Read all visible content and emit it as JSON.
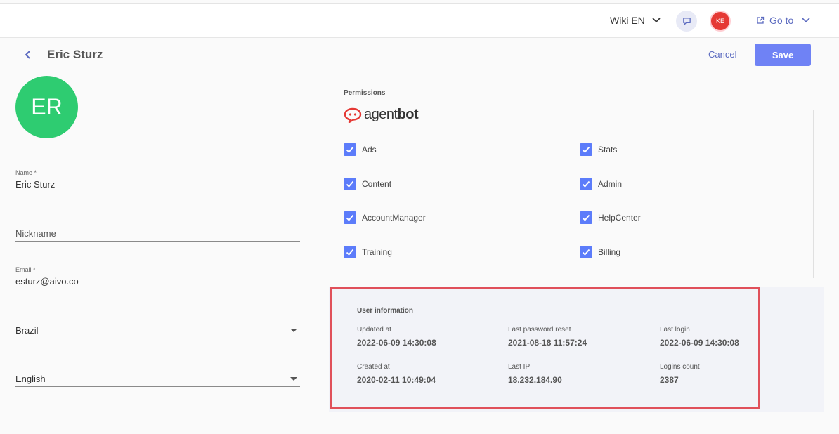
{
  "header": {
    "language": "Wiki EN",
    "user_initials": "KE",
    "goto_label": "Go to"
  },
  "page": {
    "title": "Eric Sturz",
    "cancel_label": "Cancel",
    "save_label": "Save",
    "avatar_initials": "ER"
  },
  "form": {
    "name_label": "Name *",
    "name_value": "Eric Sturz",
    "nickname_placeholder": "Nickname",
    "email_label": "Email *",
    "email_value": "esturz@aivo.co",
    "country_value": "Brazil",
    "language_value": "English"
  },
  "permissions": {
    "title": "Permissions",
    "logo_text_light": "agent",
    "logo_text_bold": "bot",
    "items": [
      {
        "label": "Ads",
        "checked": true
      },
      {
        "label": "Stats",
        "checked": true
      },
      {
        "label": "Content",
        "checked": true
      },
      {
        "label": "Admin",
        "checked": true
      },
      {
        "label": "AccountManager",
        "checked": true
      },
      {
        "label": "HelpCenter",
        "checked": true
      },
      {
        "label": "Training",
        "checked": true
      },
      {
        "label": "Billing",
        "checked": true
      }
    ]
  },
  "user_info": {
    "title": "User information",
    "updated_at_label": "Updated at",
    "updated_at": "2022-06-09 14:30:08",
    "last_password_reset_label": "Last password reset",
    "last_password_reset": "2021-08-18 11:57:24",
    "last_login_label": "Last login",
    "last_login": "2022-06-09 14:30:08",
    "created_at_label": "Created at",
    "created_at": "2020-02-11 10:49:04",
    "last_ip_label": "Last IP",
    "last_ip": "18.232.184.90",
    "logins_count_label": "Logins count",
    "logins_count": "2387"
  },
  "colors": {
    "accent": "#6f82f5",
    "avatar": "#2ecc71",
    "highlight_border": "#e0505a"
  }
}
